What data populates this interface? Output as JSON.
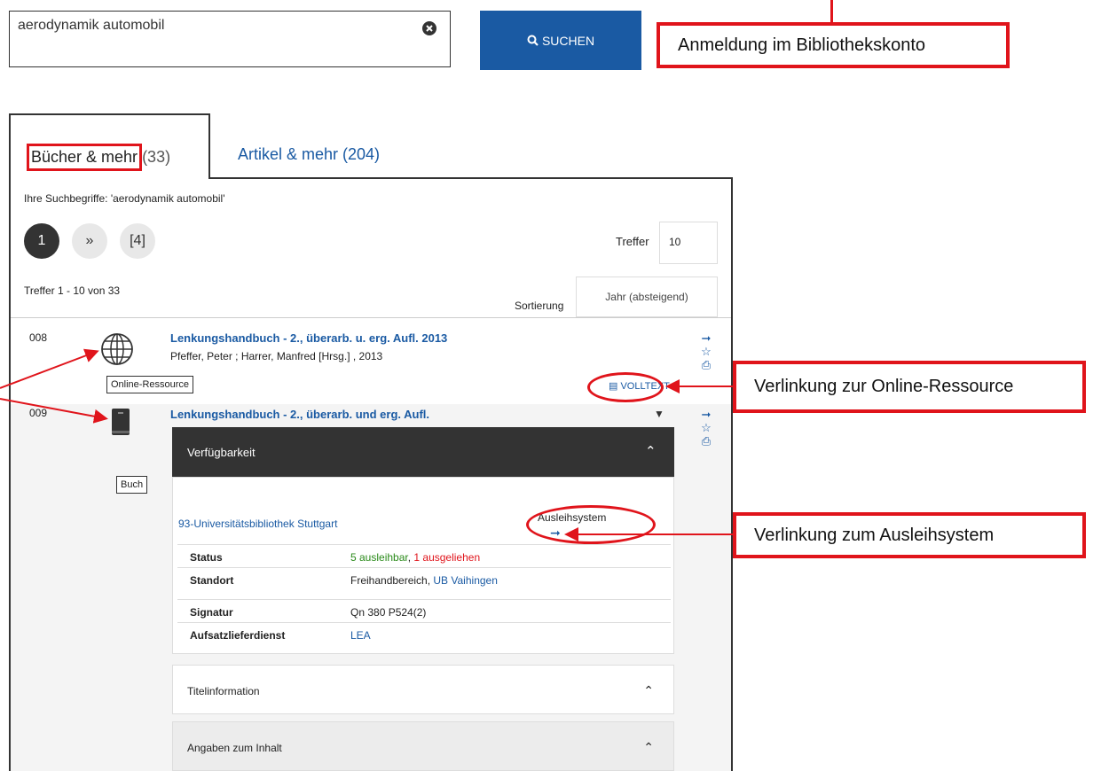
{
  "search": {
    "value": "aerodynamik automobil",
    "button_label": "SUCHEN",
    "clear_icon": "close-circle-icon",
    "search_icon": "search-icon"
  },
  "callouts": {
    "login": "Anmeldung im Bibliothekskonto",
    "online": "Verlinkung zur Online-Ressource",
    "ausleih": "Verlinkung zum Ausleihsystem"
  },
  "tabs": [
    {
      "label": "Bücher & mehr",
      "count": "(33)",
      "active": true
    },
    {
      "label": "Artikel & mehr (204)",
      "active": false
    }
  ],
  "results": {
    "search_terms": "Ihre Suchbegriffe: 'aerodynamik automobil'",
    "pagination": {
      "current": "1",
      "next": "»",
      "last": "[4]"
    },
    "hits_label": "Treffer",
    "hits_value": "10",
    "range": "Treffer 1 - 10 von 33",
    "sort_label": "Sortierung",
    "sort_value": "Jahr (absteigend)"
  },
  "items": [
    {
      "number": "008",
      "icon": "globe-icon",
      "type_tooltip": "Online-Ressource",
      "title": "Lenkungshandbuch - 2., überarb. u. erg. Aufl. 2013",
      "authors": "Pfeffer, Peter ; Harrer, Manfred [Hrsg.] , 2013",
      "fulltext_label": "VOLLTEXT"
    },
    {
      "number": "009",
      "icon": "book-icon",
      "type_tooltip": "Buch",
      "title": "Lenkungshandbuch - 2., überarb. und erg. Aufl.",
      "toggle": "▼",
      "availability": {
        "header": "Verfügbarkeit",
        "library": "93-Universitätsbibliothek Stuttgart",
        "loan_system_label": "Ausleihsystem",
        "details": {
          "status_key": "Status",
          "status_available": "5 ausleihbar",
          "status_sep": ", ",
          "status_loaned": "1 ausgeliehen",
          "location_key": "Standort",
          "location_text": "Freihandbereich, ",
          "location_link": "UB Vaihingen",
          "signature_key": "Signatur",
          "signature_value": "Qn 380 P524(2)",
          "delivery_key": "Aufsatzlieferdienst",
          "delivery_value": "LEA"
        }
      },
      "sections": [
        "Titelinformation",
        "Angaben zum Inhalt"
      ]
    }
  ],
  "colors": {
    "accent": "#1a5aa3",
    "annotation": "#e0141b",
    "available": "#2a8a1a",
    "dark_header": "#333333"
  }
}
